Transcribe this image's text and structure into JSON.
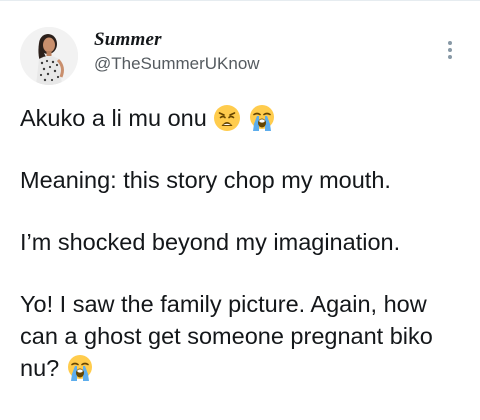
{
  "author": {
    "display_name": "Summer",
    "handle": "@TheSummerUKnow",
    "avatar_icon": "profile-photo"
  },
  "menu": {
    "icon": "more-vertical-icon"
  },
  "tweet": {
    "line1": "Akuko a li mu onu",
    "line2": "Meaning: this story chop my mouth.",
    "line3": "I’m shocked beyond my imagination.",
    "line4": "Yo! I saw the family picture. Again, how can a ghost get someone pregnant biko nu?",
    "emojis": [
      "weary-face-emoji",
      "loudly-crying-face-emoji"
    ]
  },
  "colors": {
    "text": "#14171a",
    "secondary": "#555b60",
    "divider": "#e6ecf0",
    "emoji_yellow": "#ffcc4d",
    "tear_blue": "#5dadec"
  }
}
